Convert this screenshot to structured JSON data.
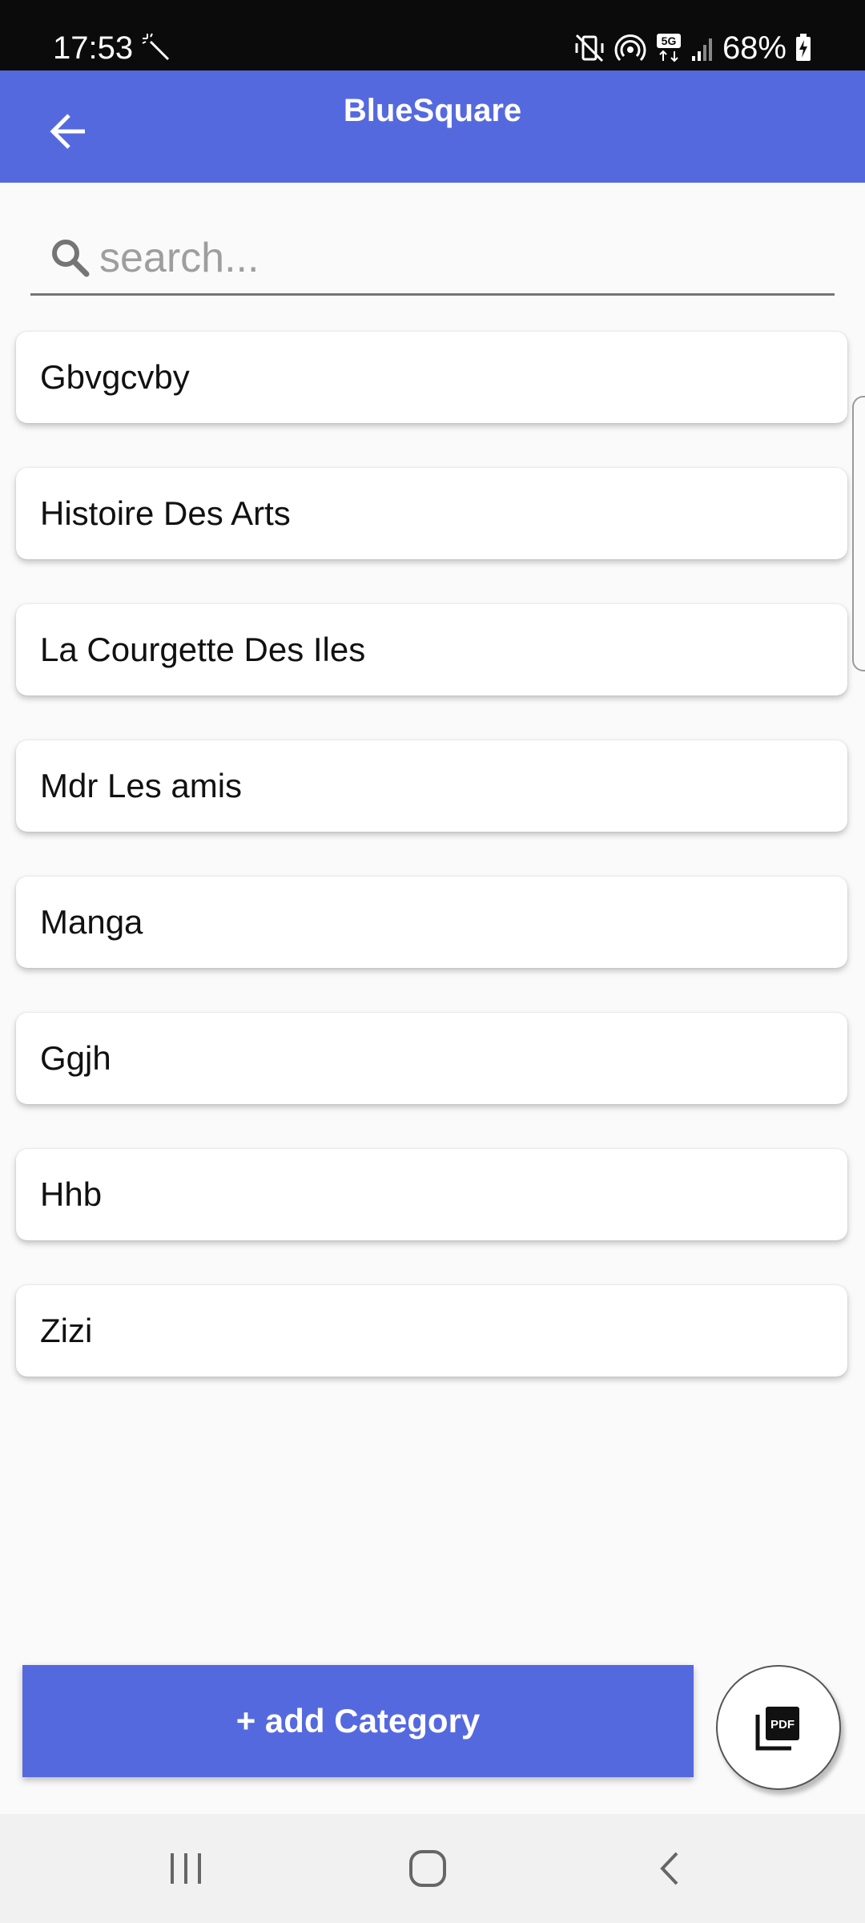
{
  "status_bar": {
    "time": "17:53",
    "battery": "68%",
    "icons": [
      "magic-wand-icon",
      "vibrate-mute-icon",
      "hotspot-icon",
      "5g-icon",
      "signal-icon",
      "battery-charging-icon"
    ]
  },
  "app_bar": {
    "title": "BlueSquare",
    "back_icon": "arrow-back-icon"
  },
  "search": {
    "placeholder": "search...",
    "value": "",
    "icon": "search-icon"
  },
  "categories": [
    {
      "label": "Gbvgcvby"
    },
    {
      "label": "Histoire Des Arts"
    },
    {
      "label": "La Courgette Des Iles"
    },
    {
      "label": "Mdr Les amis"
    },
    {
      "label": "Manga"
    },
    {
      "label": "Ggjh"
    },
    {
      "label": "Hhb"
    },
    {
      "label": "Zizi"
    }
  ],
  "actions": {
    "add_category_label": "+ add Category",
    "pdf_icon": "pdf-icon"
  },
  "colors": {
    "primary": "#5569df",
    "status_bar": "#0b0b0b",
    "background": "#fafafa"
  },
  "nav_bar": {
    "buttons": [
      "recent-apps-icon",
      "home-icon",
      "back-icon"
    ]
  }
}
